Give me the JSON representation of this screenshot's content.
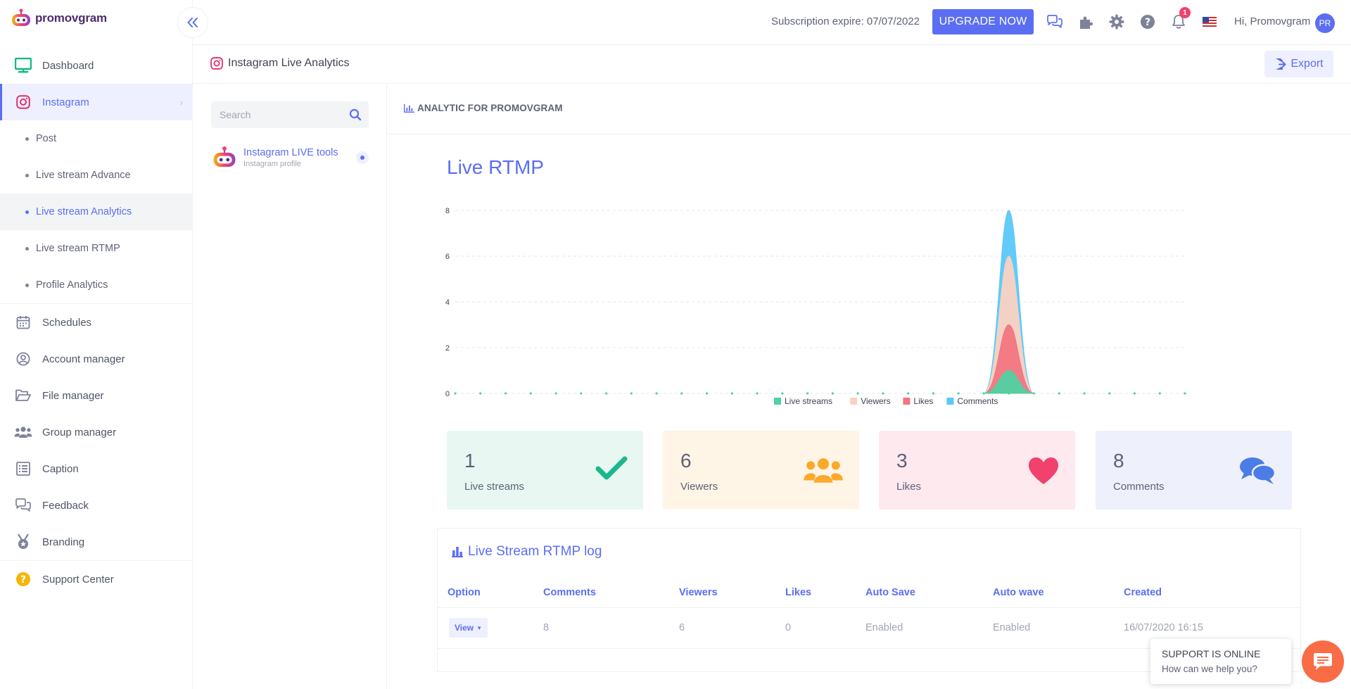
{
  "brand": {
    "name": "promovgram",
    "collapse_icon": "double-chevron-left-icon"
  },
  "sidebar": {
    "items": [
      {
        "label": "Dashboard",
        "icon": "monitor-icon",
        "color": "#10b981"
      },
      {
        "label": "Instagram",
        "icon": "instagram-icon",
        "color": "#e1306c",
        "active": true
      },
      {
        "label": "Schedules",
        "icon": "calendar-icon"
      },
      {
        "label": "Account manager",
        "icon": "user-circle-icon"
      },
      {
        "label": "File manager",
        "icon": "folder-icon"
      },
      {
        "label": "Group manager",
        "icon": "users-icon"
      },
      {
        "label": "Caption",
        "icon": "list-icon"
      },
      {
        "label": "Feedback",
        "icon": "chat-bubbles-icon"
      },
      {
        "label": "Branding",
        "icon": "medal-icon"
      },
      {
        "label": "Support Center",
        "icon": "question-circle-icon",
        "color": "#f5b50c"
      }
    ],
    "sub_items": [
      {
        "label": "Post"
      },
      {
        "label": "Live stream Advance"
      },
      {
        "label": "Live stream Analytics",
        "active": true
      },
      {
        "label": "Live stream RTMP"
      },
      {
        "label": "Profile Analytics"
      }
    ]
  },
  "topbar": {
    "subscription_text": "Subscription expire: 07/07/2022",
    "upgrade_label": "UPGRADE NOW",
    "notification_count": "1",
    "greeting": "Hi, Promovgram",
    "avatar_initials": "PR",
    "icons": [
      "chat-icon",
      "puzzle-icon",
      "gear-icon",
      "help-icon",
      "bell-icon",
      "us-flag-icon"
    ]
  },
  "page": {
    "title": "Instagram Live Analytics",
    "export_label": "Export"
  },
  "profiles": {
    "search_placeholder": "Search",
    "items": [
      {
        "name": "Instagram LIVE tools",
        "type": "Instagram profile"
      }
    ]
  },
  "analytic": {
    "heading": "ANALYTIC FOR PROMOVGRAM",
    "chart_title": "Live RTMP"
  },
  "chart_data": {
    "type": "area",
    "title": "Live RTMP",
    "xlabel": "",
    "ylabel": "",
    "ylim": [
      0,
      8
    ],
    "y_ticks": [
      "0",
      "2",
      "4",
      "6",
      "8"
    ],
    "points": 30,
    "peak_index": 22,
    "grid": true,
    "legend_position": "bottom",
    "series": [
      {
        "name": "Live streams",
        "color": "#50d1a2",
        "values": [
          0,
          0,
          0,
          0,
          0,
          0,
          0,
          0,
          0,
          0,
          0,
          0,
          0,
          0,
          0,
          0,
          0,
          0,
          0,
          0,
          0,
          0,
          1,
          0,
          0,
          0,
          0,
          0,
          0,
          0
        ]
      },
      {
        "name": "Viewers",
        "color": "#f9d2c1",
        "values": [
          0,
          0,
          0,
          0,
          0,
          0,
          0,
          0,
          0,
          0,
          0,
          0,
          0,
          0,
          0,
          0,
          0,
          0,
          0,
          0,
          0,
          0,
          6,
          0,
          0,
          0,
          0,
          0,
          0,
          0
        ]
      },
      {
        "name": "Likes",
        "color": "#f2767f",
        "values": [
          0,
          0,
          0,
          0,
          0,
          0,
          0,
          0,
          0,
          0,
          0,
          0,
          0,
          0,
          0,
          0,
          0,
          0,
          0,
          0,
          0,
          0,
          3,
          0,
          0,
          0,
          0,
          0,
          0,
          0
        ]
      },
      {
        "name": "Comments",
        "color": "#5ac8fa",
        "values": [
          0,
          0,
          0,
          0,
          0,
          0,
          0,
          0,
          0,
          0,
          0,
          0,
          0,
          0,
          0,
          0,
          0,
          0,
          0,
          0,
          0,
          0,
          8,
          0,
          0,
          0,
          0,
          0,
          0,
          0
        ]
      }
    ]
  },
  "stats": [
    {
      "value": "1",
      "label": "Live streams",
      "bg": "#e8f7f2",
      "icon": "check-icon",
      "color": "#1bb88b"
    },
    {
      "value": "6",
      "label": "Viewers",
      "bg": "#fff5e6",
      "icon": "users-icon",
      "color": "#fba92b"
    },
    {
      "value": "3",
      "label": "Likes",
      "bg": "#fde9ee",
      "icon": "heart-icon",
      "color": "#f1416c"
    },
    {
      "value": "8",
      "label": "Comments",
      "bg": "#eef0fb",
      "icon": "comments-icon",
      "color": "#4c7de6"
    }
  ],
  "log": {
    "title": "Live Stream RTMP log",
    "columns": [
      "Option",
      "Comments",
      "Viewers",
      "Likes",
      "Auto Save",
      "Auto wave",
      "Created"
    ],
    "rows": [
      {
        "option": "View",
        "comments": "8",
        "viewers": "6",
        "likes": "0",
        "auto_save": "Enabled",
        "auto_wave": "Enabled",
        "created": "16/07/2020 16:15"
      }
    ]
  },
  "support": {
    "line1": "SUPPORT IS ONLINE",
    "line2": "How can we help you?"
  }
}
